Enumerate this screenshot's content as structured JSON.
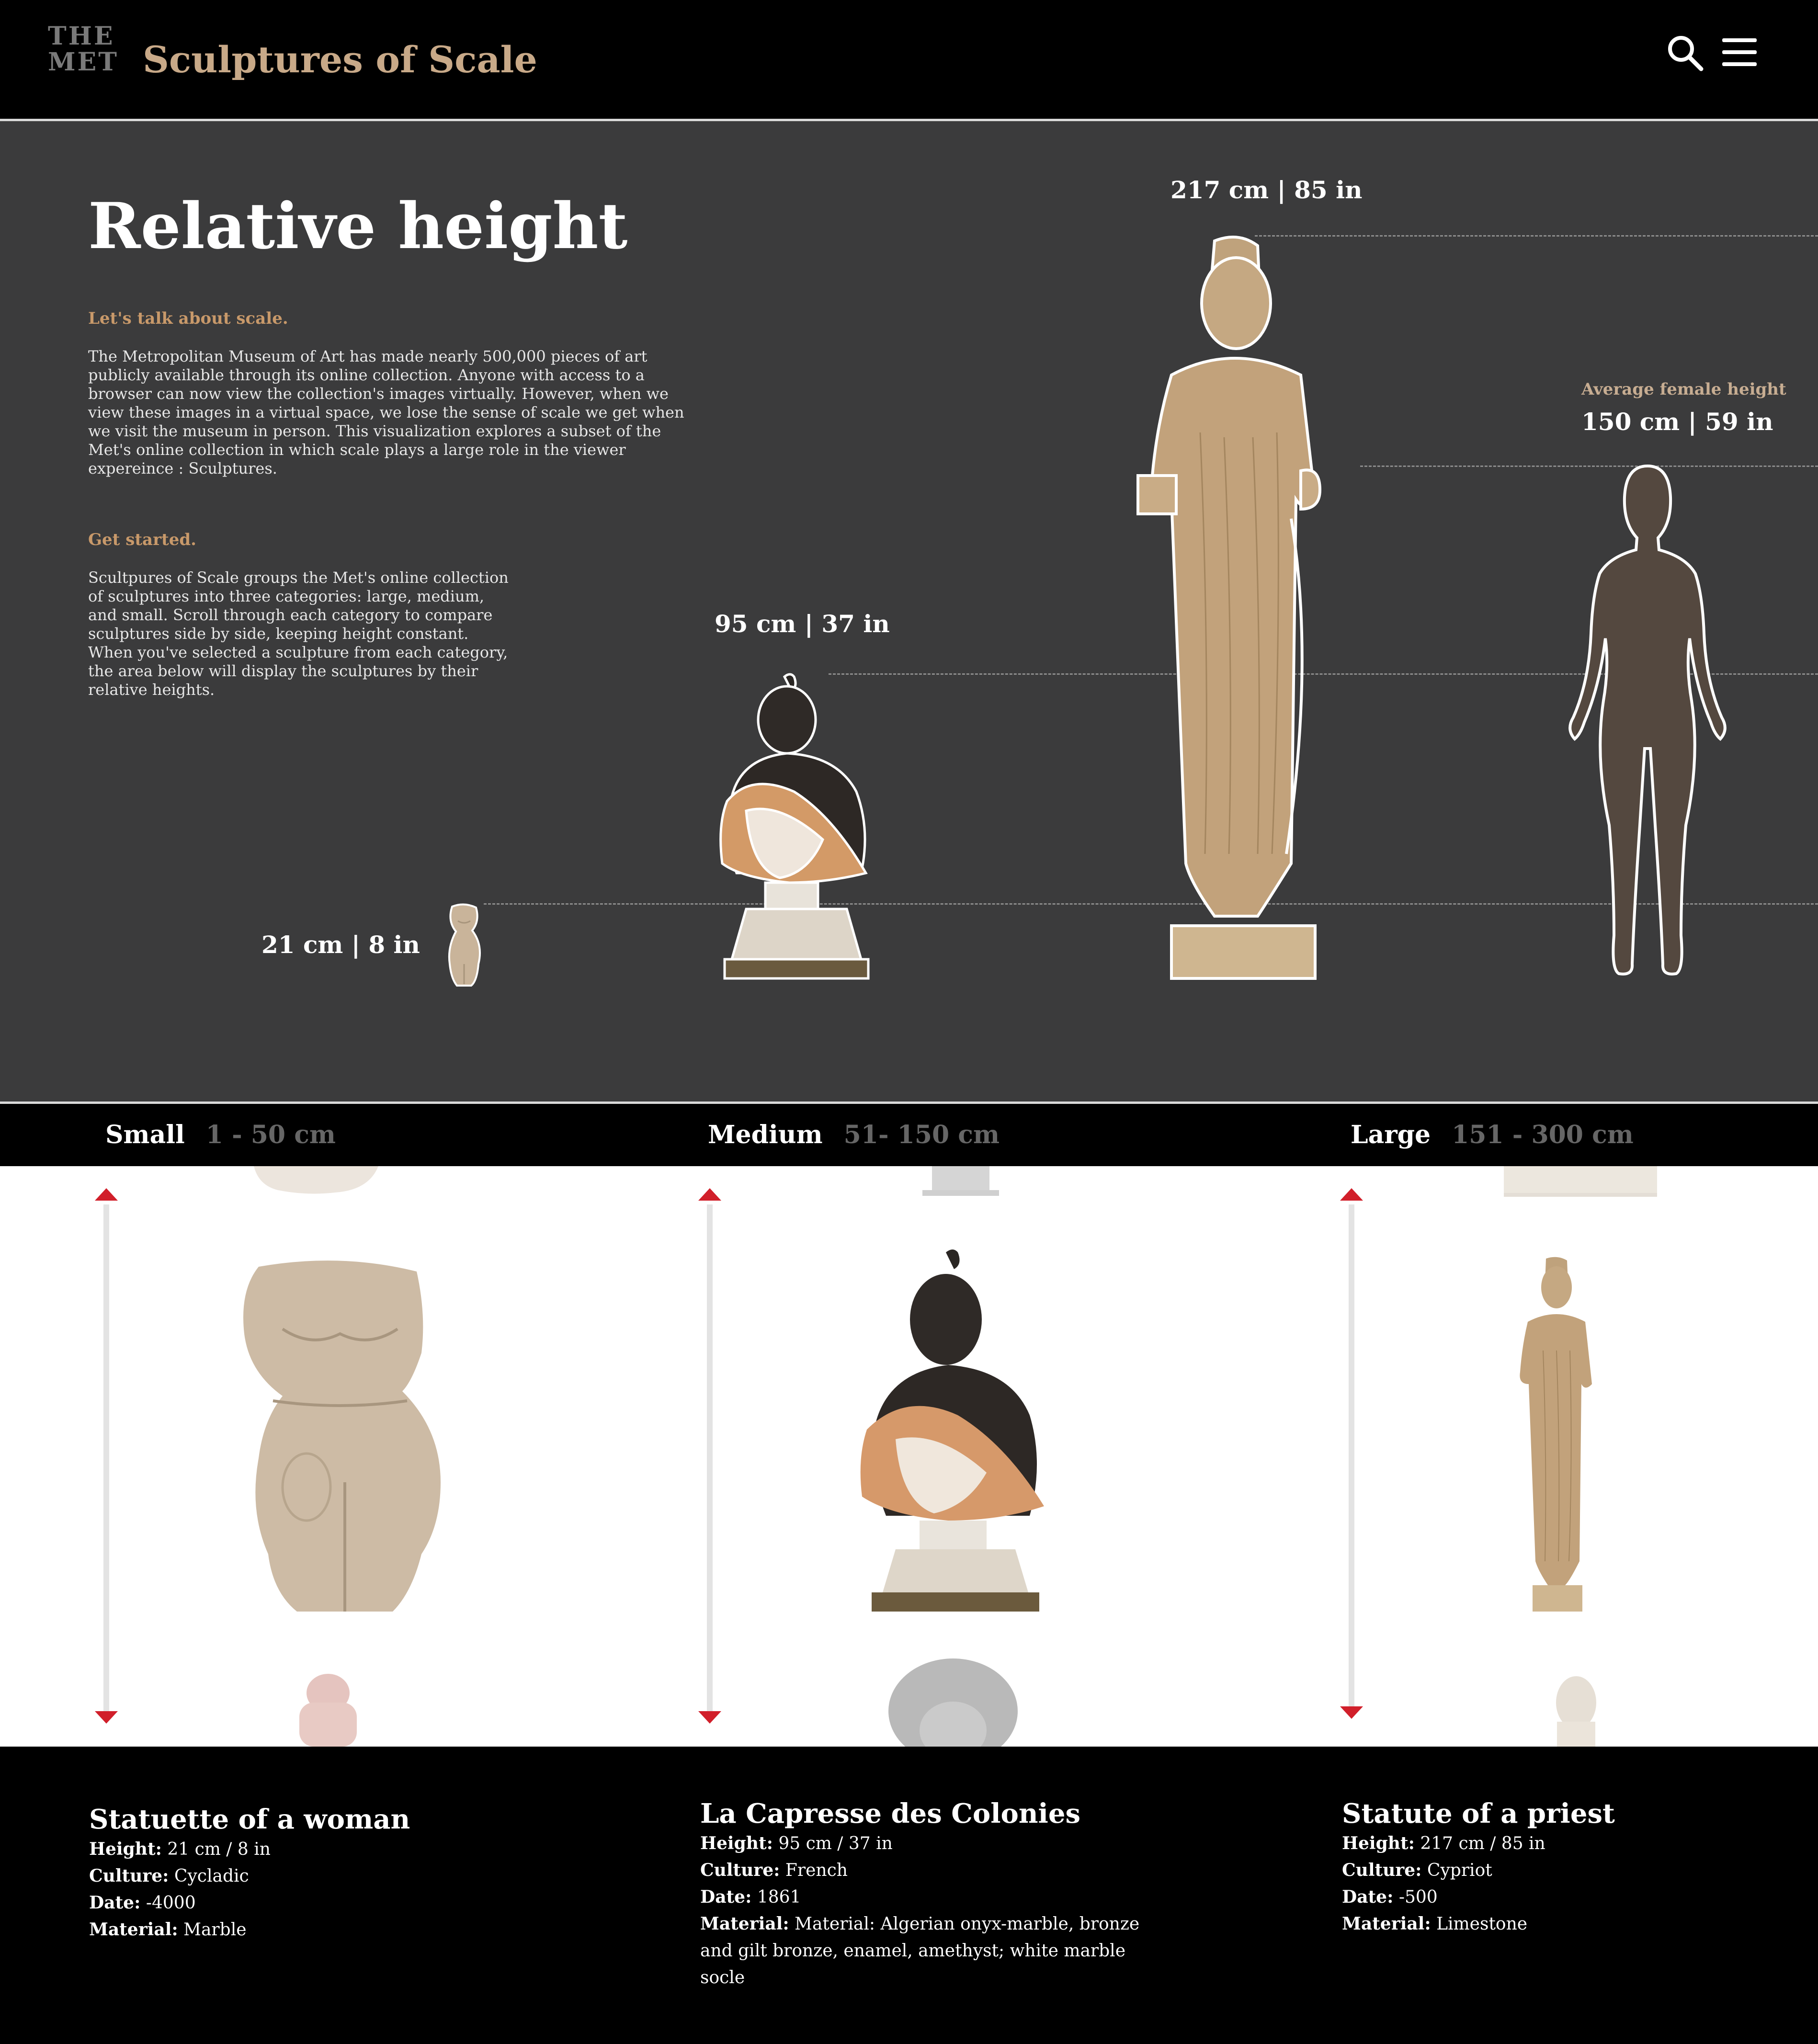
{
  "header": {
    "logo_line1": "THE",
    "logo_line2": "MET",
    "title": "Sculptures of Scale",
    "search_icon": "search-icon",
    "menu_icon": "hamburger-menu-icon"
  },
  "hero": {
    "title": "Relative height",
    "section1_heading": "Let's talk about scale.",
    "section1_body": "The Metropolitan Museum of Art has made nearly 500,000 pieces of art publicly available through its online collection. Anyone with access to a browser can now view the collection's images virtually. However, when we view these images in a virtual space, we lose the sense of scale we get when we visit the museum in person. This visualization explores a subset of the Met's online collection in which scale plays a large role in the viewer expereince : Sculptures.",
    "section2_heading": "Get started.",
    "section2_body": "Scultpures of Scale groups the Met's online collection of sculptures into three categories: large, medium, and small. Scroll through each category to compare sculptures side by side, keeping height constant. When you've selected a sculpture from each category, the area below will display the sculptures by their relative heights.",
    "small_label": "21 cm | 8 in",
    "medium_label": "95 cm | 37 in",
    "large_label": "217 cm | 85 in",
    "average_caption": "Average female height",
    "average_label": "150 cm | 59 in"
  },
  "categories": [
    {
      "name": "Small",
      "range": "1 - 50 cm"
    },
    {
      "name": "Medium",
      "range": "51- 150 cm"
    },
    {
      "name": "Large",
      "range": "151 - 300 cm"
    }
  ],
  "details": [
    {
      "title": "Statuette of a woman",
      "height_label": "Height:",
      "height": "21 cm / 8 in",
      "culture_label": "Culture:",
      "culture": "Cycladic",
      "date_label": "Date:",
      "date": "-4000",
      "material_label": "Material:",
      "material": "Marble"
    },
    {
      "title": "La Capresse des Colonies",
      "height_label": "Height:",
      "height": "95 cm / 37 in",
      "culture_label": "Culture:",
      "culture": "French",
      "date_label": "Date:",
      "date": "1861",
      "material_label": "Material:",
      "material": "Material: Algerian onyx-marble, bronze and gilt bronze, enamel, amethyst; white marble socle"
    },
    {
      "title": "Statute of a priest",
      "height_label": "Height:",
      "height": "217 cm / 85 in",
      "culture_label": "Culture:",
      "culture": "Cypriot",
      "date_label": "Date:",
      "date": "-500",
      "material_label": "Material:",
      "material": "Limestone"
    }
  ],
  "colors": {
    "accent_gold": "#c8a988",
    "hero_background": "#3b3b3c",
    "arrow_red": "#d11f2a",
    "silhouette": "#54483f"
  }
}
